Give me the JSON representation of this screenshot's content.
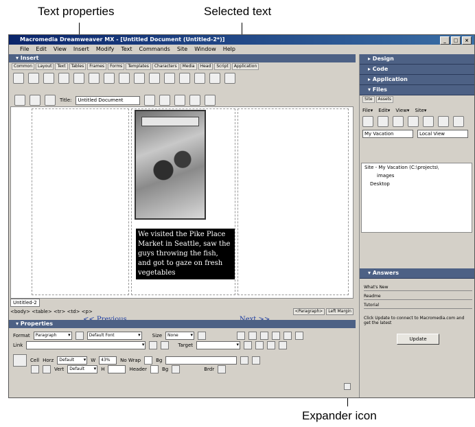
{
  "callouts": {
    "text_properties": "Text properties",
    "selected_text": "Selected text",
    "expander_icon": "Expander icon"
  },
  "window": {
    "title": "Macromedia Dreamweaver MX - [Untitled Document (Untitled-2*)]",
    "menus": [
      "File",
      "Edit",
      "View",
      "Insert",
      "Modify",
      "Text",
      "Commands",
      "Site",
      "Window",
      "Help"
    ]
  },
  "insert_panel": {
    "title": "▾ Insert",
    "tabs": [
      "Common",
      "Layout",
      "Text",
      "Tables",
      "Frames",
      "Forms",
      "Templates",
      "Characters",
      "Media",
      "Head",
      "Script",
      "Application"
    ]
  },
  "doc_toolbar": {
    "title_label": "Title:",
    "title_value": "Untitled Document"
  },
  "document": {
    "selected_text": "We visited the Pike Place Market in Seattle, saw the guys throwing the fish, and got to gaze on fresh vegetables",
    "prev_link": "<< Previous",
    "next_link": "Next >>",
    "doc_tab": "Untitled-2",
    "status_left": "<body> <table> <tr> <td> <p>",
    "tag_buttons": [
      "<Paragraph>",
      "Left Margin"
    ]
  },
  "properties": {
    "title": "▾ Properties",
    "format_label": "Format",
    "format_value": "Paragraph",
    "font_value": "Default Font",
    "size_label": "Size",
    "size_value": "None",
    "link_label": "Link",
    "target_label": "Target",
    "cell_label": "Cell",
    "horz_label": "Horz",
    "horz_value": "Default",
    "vert_label": "Vert",
    "vert_value": "Default",
    "w_label": "W",
    "w_value": "43%",
    "h_label": "H",
    "nowrap_label": "No Wrap",
    "header_label": "Header",
    "bg_label": "Bg",
    "brdr_label": "Brdr"
  },
  "right_panels": {
    "design": "▸ Design",
    "code": "▸ Code",
    "application": "▸ Application",
    "files": "▾ Files",
    "files_tabs": [
      "Site",
      "Assets"
    ],
    "files_menu": [
      "File▾",
      "Edit▾",
      "View▾",
      "Site▾"
    ],
    "site_select": "My Vacation",
    "view_select": "Local View",
    "tree": [
      "Site - My Vacation (C:\\projects\\",
      "images",
      "Desktop"
    ],
    "answers": "▾ Answers",
    "answer_items": [
      "What's New",
      "Readme",
      "Tutorial"
    ],
    "answer_text": "Click Update to connect to Macromedia.com and get the latest",
    "update_button": "Update"
  }
}
